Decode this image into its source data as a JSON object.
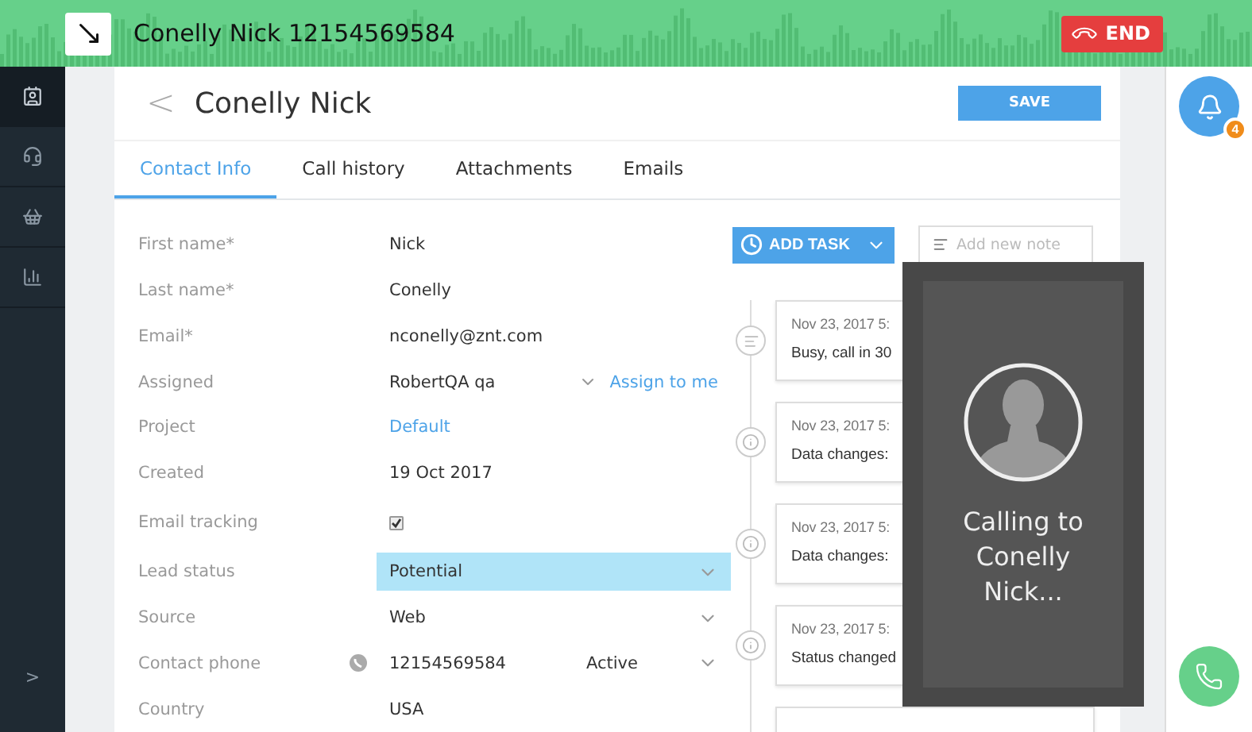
{
  "call_bar": {
    "title": "Conelly Nick 12154569584",
    "end_button": "END"
  },
  "sidebar": {
    "items": [
      {
        "selected": true
      },
      {
        "selected": false
      },
      {
        "selected": false
      },
      {
        "selected": false
      }
    ],
    "expand_label": ">"
  },
  "contact": {
    "back": "<",
    "title": "Conelly Nick",
    "save_button": "SAVE"
  },
  "tabs": [
    {
      "label": "Contact Info",
      "selected": true
    },
    {
      "label": "Call history",
      "selected": false
    },
    {
      "label": "Attachments",
      "selected": false
    },
    {
      "label": "Emails",
      "selected": false
    }
  ],
  "fields": [
    {
      "kind": "text",
      "label": "First name*",
      "value": "Nick"
    },
    {
      "kind": "text",
      "label": "Last name*",
      "value": "Conelly"
    },
    {
      "kind": "text",
      "label": "Email*",
      "value": "nconelly@znt.com"
    },
    {
      "kind": "assigned",
      "label": "Assigned",
      "value": "RobertQA qa",
      "action": "Assign to me"
    },
    {
      "kind": "link",
      "label": "Project",
      "value": "Default"
    },
    {
      "kind": "text",
      "label": "Created",
      "value": "19 Oct 2017"
    },
    {
      "kind": "checkbox",
      "label": "Email tracking",
      "checked": true
    },
    {
      "kind": "select",
      "label": "Lead status",
      "value": "Potential",
      "highlighted": true
    },
    {
      "kind": "select",
      "label": "Source",
      "value": "Web",
      "highlighted": false
    },
    {
      "kind": "phone",
      "label": "Contact phone",
      "value": "12154569584",
      "status": "Active"
    },
    {
      "kind": "text",
      "label": "Country",
      "value": "USA"
    }
  ],
  "actions": {
    "add_task": "ADD TASK",
    "note": {
      "placeholder": "Add new note"
    }
  },
  "timeline": [
    {
      "kind": "note",
      "date": "Nov 23, 2017 5:",
      "text": "Busy, call in 30"
    },
    {
      "kind": "info",
      "date": "Nov 23, 2017 5:",
      "text": "Data changes:"
    },
    {
      "kind": "info",
      "date": "Nov 23, 2017 5:",
      "text": "Data changes:"
    },
    {
      "kind": "info",
      "date": "Nov 23, 2017 5:",
      "text": "Status changed"
    },
    {
      "kind": "empty"
    }
  ],
  "calling": {
    "text": "Calling to Conelly Nick..."
  },
  "notifications": {
    "badge": "4"
  }
}
